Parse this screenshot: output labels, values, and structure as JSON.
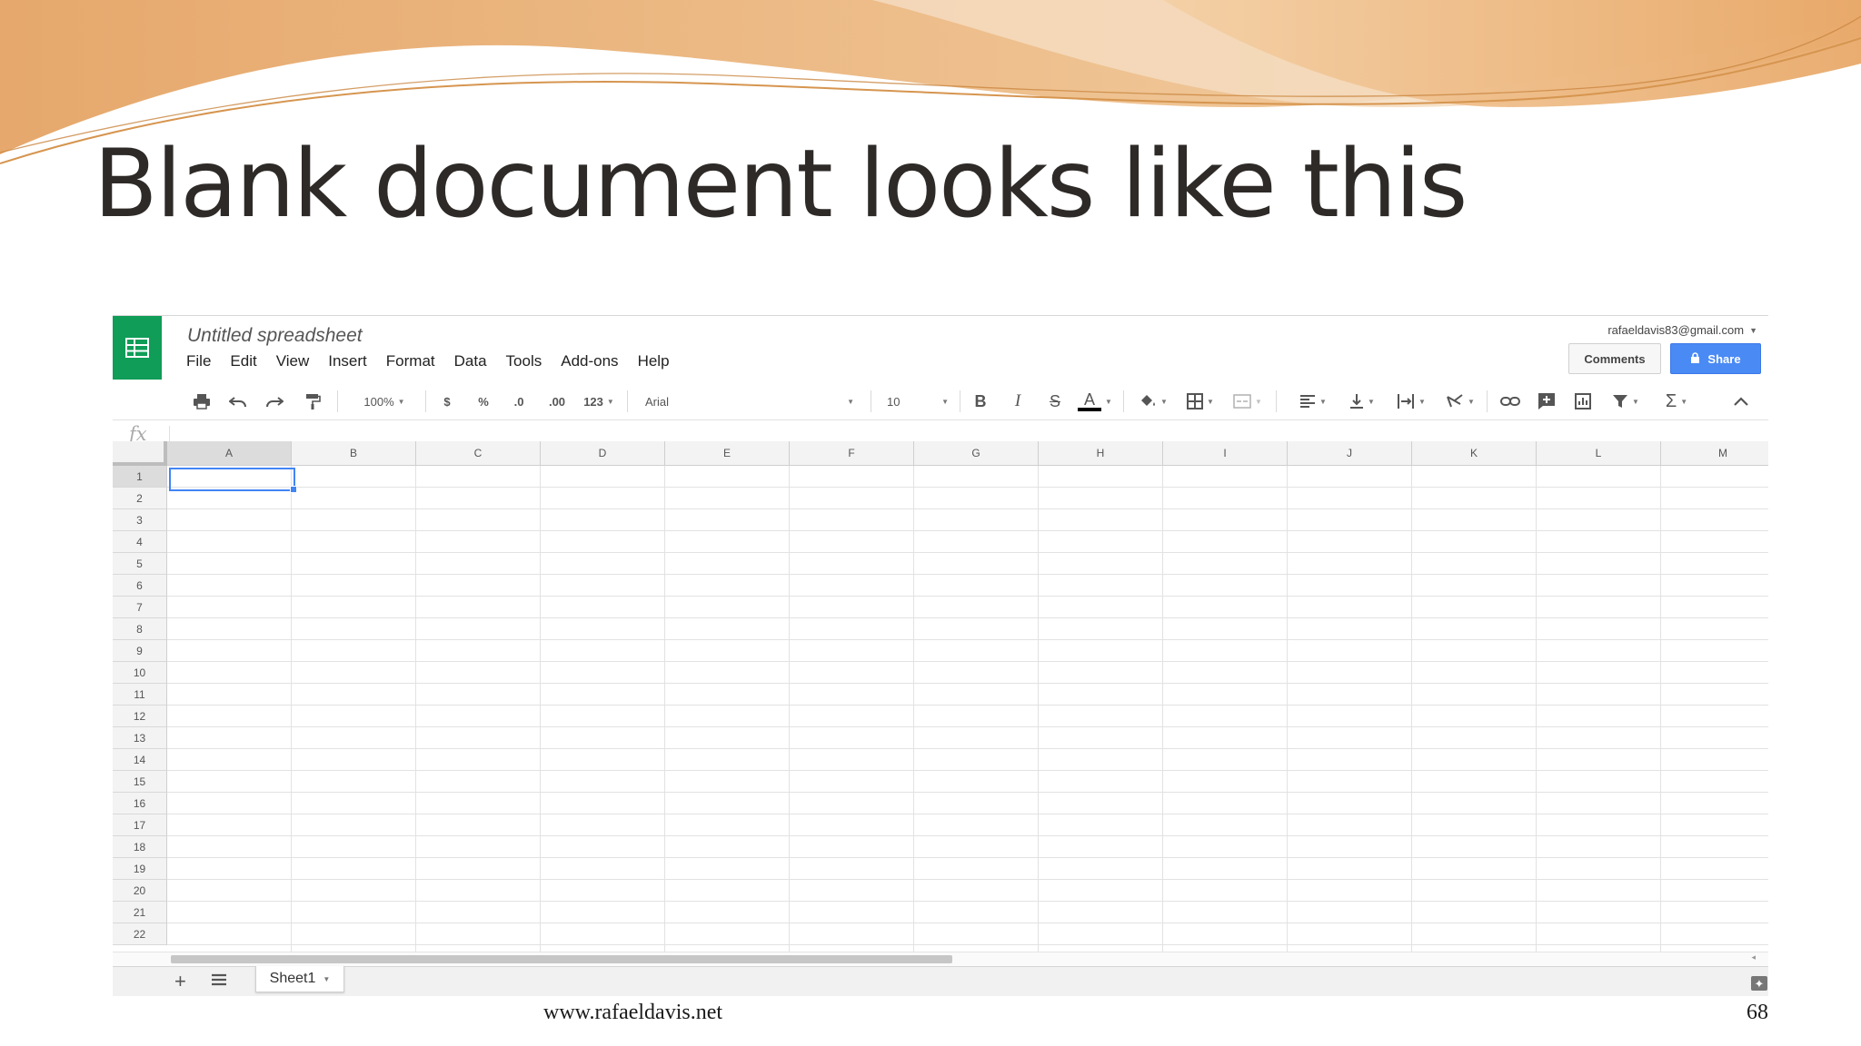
{
  "slide": {
    "title": "Blank document looks like this",
    "footer_url": "www.rafaeldavis.net",
    "page_number": "68"
  },
  "app": {
    "doc_title": "Untitled spreadsheet",
    "menu": [
      "File",
      "Edit",
      "View",
      "Insert",
      "Format",
      "Data",
      "Tools",
      "Add-ons",
      "Help"
    ],
    "account_email": "rafaeldavis83@gmail.com",
    "comments_label": "Comments",
    "share_label": "Share",
    "brand_color": "#0f9d58",
    "accent_color": "#4285f4"
  },
  "toolbar": {
    "zoom": "100%",
    "currency": "$",
    "percent": "%",
    "decrease_decimal": ".0",
    "increase_decimal": ".00",
    "more_formats": "123",
    "font": "Arial",
    "font_size": "10",
    "bold": "B",
    "italic": "I",
    "strikethrough": "S",
    "text_color": "A",
    "functions": "Σ",
    "icons": [
      "print-icon",
      "undo-icon",
      "redo-icon",
      "paint-format-icon",
      "fill-color-icon",
      "borders-icon",
      "merge-cells-icon",
      "horizontal-align-icon",
      "vertical-align-icon",
      "text-wrap-icon",
      "text-rotation-icon",
      "link-icon",
      "insert-comment-icon",
      "insert-chart-icon",
      "filter-icon",
      "collapse-icon"
    ]
  },
  "formula_bar": {
    "label": "fx"
  },
  "grid": {
    "columns": [
      "A",
      "B",
      "C",
      "D",
      "E",
      "F",
      "G",
      "H",
      "I",
      "J",
      "K",
      "L",
      "M"
    ],
    "rows": [
      "1",
      "2",
      "3",
      "4",
      "5",
      "6",
      "7",
      "8",
      "9",
      "10",
      "11",
      "12",
      "13",
      "14",
      "15",
      "16",
      "17",
      "18",
      "19",
      "20",
      "21",
      "22"
    ],
    "active_cell": "A1"
  },
  "sheets": {
    "tabs": [
      "Sheet1"
    ],
    "add_label": "+"
  }
}
